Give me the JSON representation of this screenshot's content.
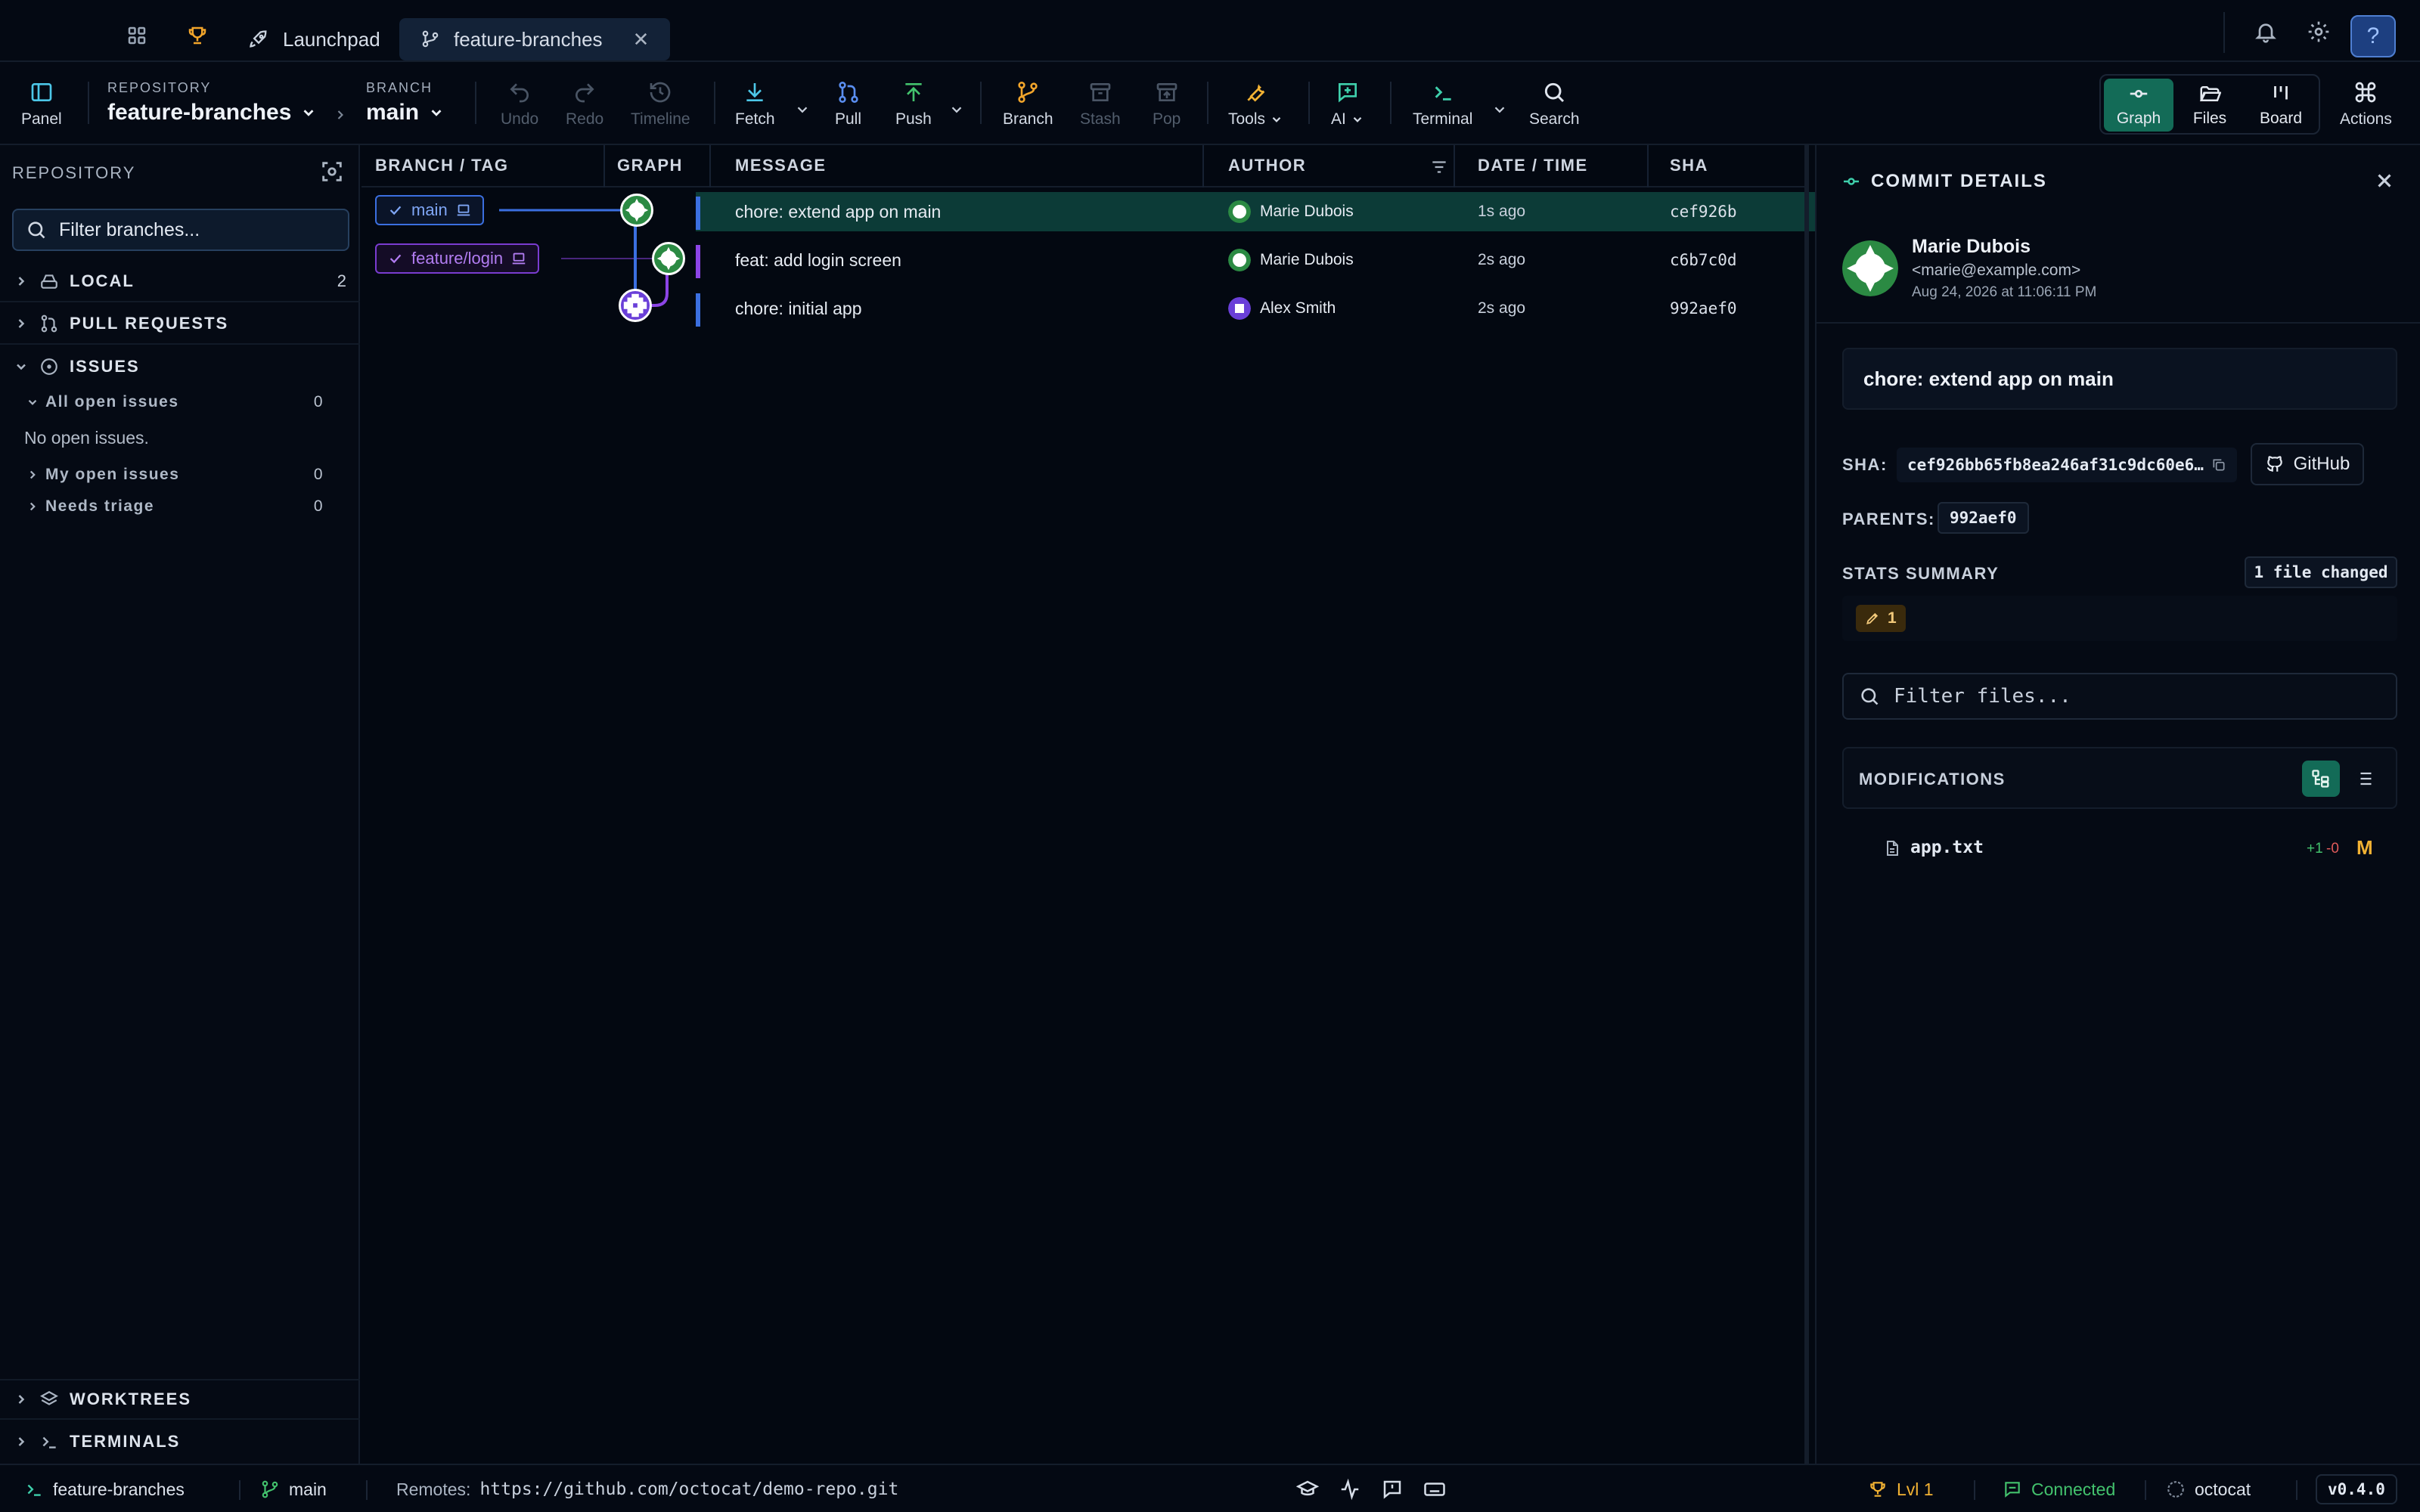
{
  "tabbar": {
    "tabs": [
      {
        "label": "Launchpad",
        "icon": "rocket-icon"
      },
      {
        "label": "feature-branches",
        "icon": "git-branch-icon",
        "active": true
      }
    ],
    "close_glyph": "✕"
  },
  "toolbar": {
    "panel_label": "Panel",
    "repository_label": "REPOSITORY",
    "repository_name": "feature-branches",
    "branch_label": "BRANCH",
    "branch_name": "main",
    "actions": {
      "undo": "Undo",
      "redo": "Redo",
      "timeline": "Timeline",
      "fetch": "Fetch",
      "pull": "Pull",
      "push": "Push",
      "branch": "Branch",
      "stash": "Stash",
      "pop": "Pop",
      "tools": "Tools",
      "ai": "AI",
      "terminal": "Terminal",
      "search": "Search"
    },
    "views": {
      "graph": "Graph",
      "files": "Files",
      "board": "Board"
    },
    "actions_label": "Actions"
  },
  "sidebar": {
    "heading": "REPOSITORY",
    "filter_placeholder": "Filter branches...",
    "sections": {
      "local": {
        "label": "LOCAL",
        "count": "2"
      },
      "pull_requests": {
        "label": "PULL REQUESTS"
      },
      "issues": {
        "label": "ISSUES",
        "all_open": {
          "label": "All open issues",
          "count": "0"
        },
        "empty_text": "No open issues.",
        "my_open": {
          "label": "My open issues",
          "count": "0"
        },
        "needs_triage": {
          "label": "Needs triage",
          "count": "0"
        }
      },
      "worktrees": {
        "label": "WORKTREES"
      },
      "terminals": {
        "label": "TERMINALS"
      }
    }
  },
  "graph": {
    "columns": {
      "branch_tag": "BRANCH / TAG",
      "graph": "GRAPH",
      "message": "MESSAGE",
      "author": "AUTHOR",
      "date_time": "DATE / TIME",
      "sha": "SHA"
    },
    "commits": [
      {
        "branch": "main",
        "message": "chore: extend app on main",
        "author": "Marie Dubois",
        "date": "1s ago",
        "sha": "cef926b",
        "lane_color": "#3b6fe0"
      },
      {
        "branch": "feature/login",
        "message": "feat: add login screen",
        "author": "Marie Dubois",
        "date": "2s ago",
        "sha": "c6b7c0d",
        "lane_color": "#8c45e6"
      },
      {
        "branch": "",
        "message": "chore: initial app",
        "author": "Alex Smith",
        "date": "2s ago",
        "sha": "992aef0",
        "lane_color": "#3b6fe0"
      }
    ]
  },
  "details": {
    "title": "COMMIT DETAILS",
    "author_name": "Marie Dubois",
    "author_email": "<marie@example.com>",
    "date": "Aug 24, 2026 at 11:06:11 PM",
    "message": "chore: extend app on main",
    "sha_label": "SHA:",
    "sha_value": "cef926bb65fb8ea246af31c9dc60e6…",
    "github_label": "GitHub",
    "parents_label": "PARENTS:",
    "parent_sha": "992aef0",
    "stats_label": "STATS SUMMARY",
    "files_changed": "1 file changed",
    "modified_count": "1",
    "filter_placeholder": "Filter files...",
    "modifications_label": "MODIFICATIONS",
    "files": [
      {
        "name": "app.txt",
        "additions": "+1",
        "deletions": "-0",
        "status": "M"
      }
    ]
  },
  "statusbar": {
    "repo": "feature-branches",
    "branch": "main",
    "remotes_label": "Remotes:",
    "remotes_url": "https://github.com/octocat/demo-repo.git",
    "level": "Lvl 1",
    "connection": "Connected",
    "user": "octocat",
    "version": "v0.4.0"
  },
  "colors": {
    "accent_teal": "#136b57",
    "selected_row": "#0c3b37",
    "main_lane": "#3b6fe0",
    "feature_lane": "#8c45e6",
    "level_gold": "#f2b233",
    "connected_green": "#43c26d"
  }
}
